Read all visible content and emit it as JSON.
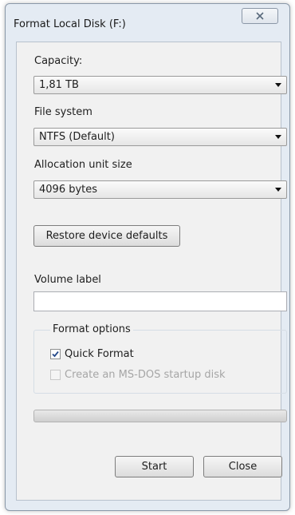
{
  "window": {
    "title": "Format Local Disk (F:)"
  },
  "capacity": {
    "label": "Capacity:",
    "value": "1,81 TB"
  },
  "file_system": {
    "label": "File system",
    "value": "NTFS (Default)"
  },
  "allocation": {
    "label": "Allocation unit size",
    "value": "4096 bytes"
  },
  "restore_button": "Restore device defaults",
  "volume": {
    "label": "Volume label",
    "value": ""
  },
  "format_options": {
    "title": "Format options",
    "quick_format": {
      "label": "Quick Format",
      "checked": true
    },
    "msdos": {
      "label": "Create an MS-DOS startup disk",
      "checked": false,
      "disabled": true
    }
  },
  "progress": {
    "fraction": 0
  },
  "buttons": {
    "start": "Start",
    "close": "Close"
  }
}
